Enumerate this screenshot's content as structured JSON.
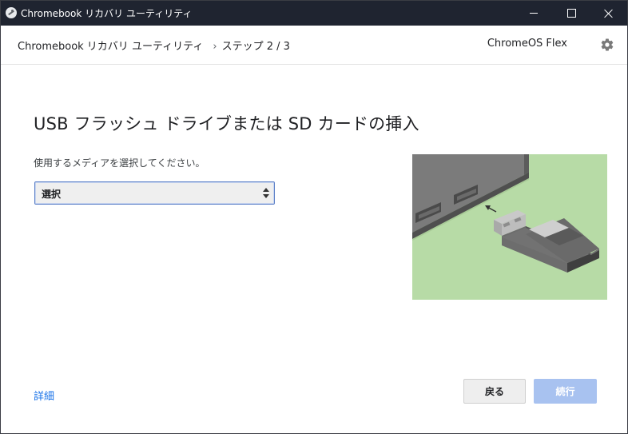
{
  "window": {
    "title": "Chromebook リカバリ ユーティリティ",
    "controls": [
      "minimize",
      "maximize",
      "close"
    ]
  },
  "header": {
    "breadcrumb_app": "Chromebook リカバリ ユーティリティ",
    "breadcrumb_separator": "›",
    "breadcrumb_step": "ステップ 2 / 3",
    "product": "ChromeOS Flex",
    "settings_icon": "gear-icon"
  },
  "main": {
    "title": "USB フラッシュ ドライブまたは SD カードの挿入",
    "instruction": "使用するメディアを選択してください。",
    "media_select": {
      "selected_value": "選択"
    },
    "illustration_icon": "usb-drive-insertion-illustration"
  },
  "footer": {
    "details_link": "詳細",
    "back_button": "戻る",
    "continue_button": "続行"
  },
  "colors": {
    "titlebar_bg": "#1f2430",
    "link": "#1a73e8",
    "continue_disabled_bg": "#a8c2f0",
    "illustration_bg": "#b7dba6"
  }
}
